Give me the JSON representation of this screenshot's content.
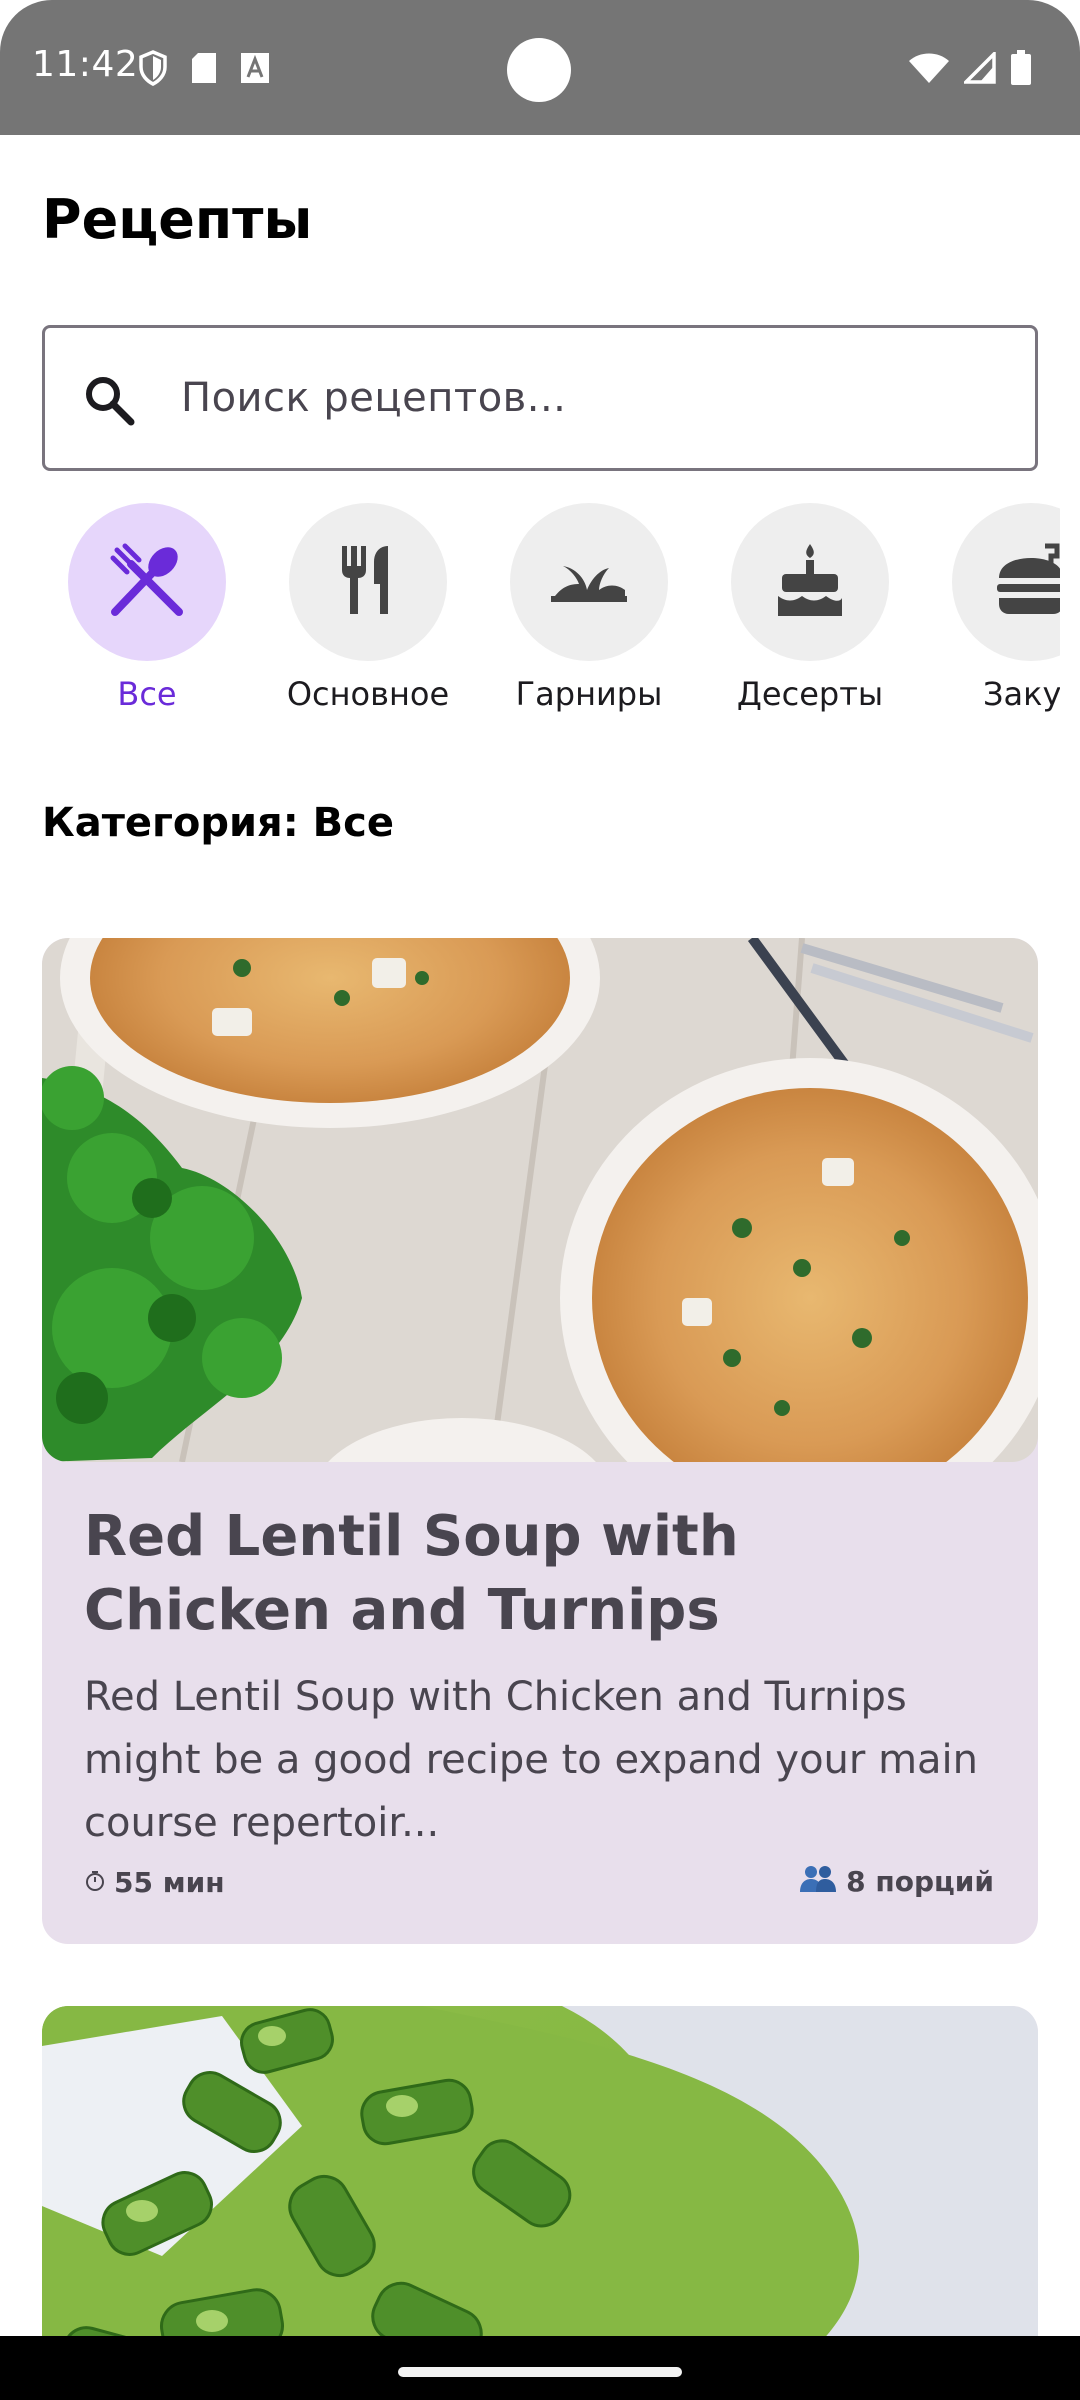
{
  "status_bar": {
    "time": "11:42",
    "icons": [
      "shield-icon",
      "sd-card-icon",
      "font-icon",
      "wifi-icon",
      "signal-icon",
      "battery-icon"
    ]
  },
  "header": {
    "title": "Рецепты"
  },
  "search": {
    "placeholder": "Поиск рецептов...",
    "value": ""
  },
  "categories": [
    {
      "label": "Все",
      "icon": "dining-icon",
      "selected": true
    },
    {
      "label": "Основное",
      "icon": "fork-knife-icon",
      "selected": false
    },
    {
      "label": "Гарниры",
      "icon": "grass-icon",
      "selected": false
    },
    {
      "label": "Десерты",
      "icon": "cake-icon",
      "selected": false
    },
    {
      "label": "Закус",
      "icon": "burger-icon",
      "selected": false
    }
  ],
  "category_heading": "Категория: Все",
  "recipes": [
    {
      "title": "Red Lentil Soup with Chicken and Turnips",
      "description": "Red Lentil Soup with Chicken and Turnips might be a good recipe to expand your main course repertoir...",
      "time": "55 мин",
      "servings": "8 порций",
      "image": "soup-bowls-photo"
    },
    {
      "title": "",
      "description": "",
      "image": "green-soup-photo"
    }
  ],
  "colors": {
    "accent": "#6a2bd9",
    "selected_circle": "#e6d6fb",
    "card_bg": "#e8dfec",
    "status_bar": "#757575"
  }
}
